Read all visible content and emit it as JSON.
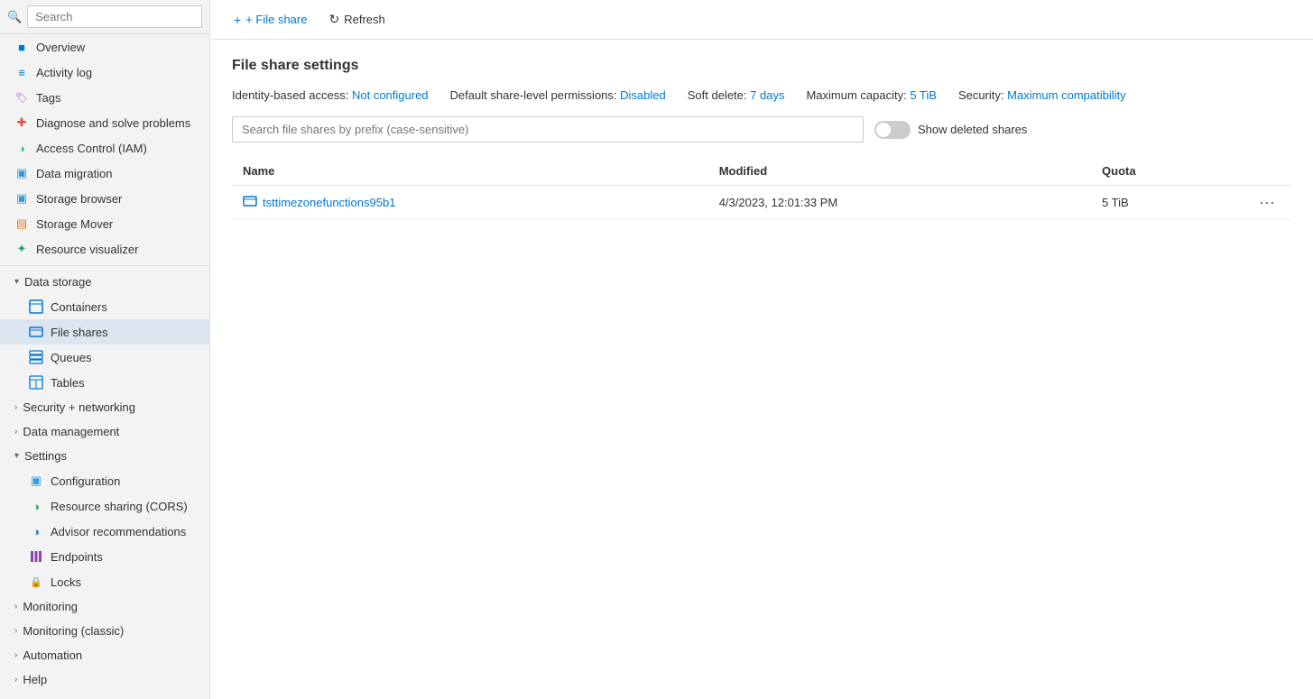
{
  "sidebar": {
    "search_placeholder": "Search",
    "items": [
      {
        "id": "overview",
        "label": "Overview",
        "icon": "■",
        "level": 0
      },
      {
        "id": "activity-log",
        "label": "Activity log",
        "icon": "≡",
        "level": 0
      },
      {
        "id": "tags",
        "label": "Tags",
        "icon": "🏷",
        "level": 0
      },
      {
        "id": "diagnose",
        "label": "Diagnose and solve problems",
        "icon": "✚",
        "level": 0
      },
      {
        "id": "access-control",
        "label": "Access Control (IAM)",
        "icon": "◑",
        "level": 0
      },
      {
        "id": "data-migration",
        "label": "Data migration",
        "icon": "▣",
        "level": 0
      },
      {
        "id": "storage-browser",
        "label": "Storage browser",
        "icon": "▣",
        "level": 0
      },
      {
        "id": "storage-mover",
        "label": "Storage Mover",
        "icon": "▤",
        "level": 0
      },
      {
        "id": "resource-visualizer",
        "label": "Resource visualizer",
        "icon": "✦",
        "level": 0
      }
    ],
    "groups": [
      {
        "id": "data-storage",
        "label": "Data storage",
        "expanded": true,
        "items": [
          {
            "id": "containers",
            "label": "Containers",
            "icon": "▦"
          },
          {
            "id": "file-shares",
            "label": "File shares",
            "icon": "▦",
            "active": true
          },
          {
            "id": "queues",
            "label": "Queues",
            "icon": "▦"
          },
          {
            "id": "tables",
            "label": "Tables",
            "icon": "▦"
          }
        ]
      },
      {
        "id": "security-networking",
        "label": "Security + networking",
        "expanded": false,
        "items": []
      },
      {
        "id": "data-management",
        "label": "Data management",
        "expanded": false,
        "items": []
      },
      {
        "id": "settings",
        "label": "Settings",
        "expanded": true,
        "items": [
          {
            "id": "configuration",
            "label": "Configuration",
            "icon": "▣"
          },
          {
            "id": "resource-sharing",
            "label": "Resource sharing (CORS)",
            "icon": "◑"
          },
          {
            "id": "advisor",
            "label": "Advisor recommendations",
            "icon": "◑"
          },
          {
            "id": "endpoints",
            "label": "Endpoints",
            "icon": "|||"
          },
          {
            "id": "locks",
            "label": "Locks",
            "icon": "🔒"
          }
        ]
      },
      {
        "id": "monitoring",
        "label": "Monitoring",
        "expanded": false,
        "items": []
      },
      {
        "id": "monitoring-classic",
        "label": "Monitoring (classic)",
        "expanded": false,
        "items": []
      },
      {
        "id": "automation",
        "label": "Automation",
        "expanded": false,
        "items": []
      },
      {
        "id": "help",
        "label": "Help",
        "expanded": false,
        "items": []
      }
    ]
  },
  "toolbar": {
    "file_share_label": "+ File share",
    "refresh_label": "Refresh"
  },
  "main": {
    "page_title": "File share settings",
    "settings": {
      "identity_label": "Identity-based access:",
      "identity_value": "Not configured",
      "permissions_label": "Default share-level permissions:",
      "permissions_value": "Disabled",
      "soft_delete_label": "Soft delete:",
      "soft_delete_value": "7 days",
      "max_capacity_label": "Maximum capacity:",
      "max_capacity_value": "5 TiB",
      "security_label": "Security:",
      "security_value": "Maximum compatibility"
    },
    "search_placeholder": "Search file shares by prefix (case-sensitive)",
    "show_deleted_label": "Show deleted shares",
    "table": {
      "columns": [
        "Name",
        "Modified",
        "Quota"
      ],
      "rows": [
        {
          "name": "tsttimezonefunctions95b1",
          "modified": "4/3/2023, 12:01:33 PM",
          "quota": "5 TiB"
        }
      ]
    }
  }
}
